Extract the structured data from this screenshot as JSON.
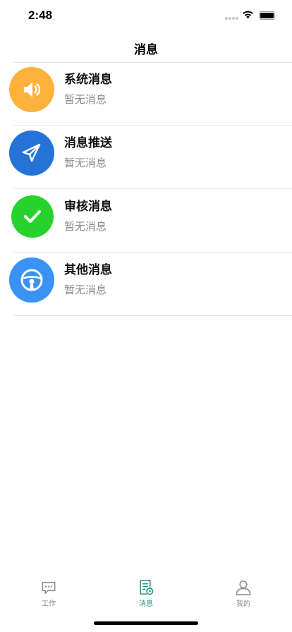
{
  "status_bar": {
    "time": "2:48"
  },
  "header": {
    "title": "消息"
  },
  "messages": [
    {
      "title": "系统消息",
      "subtitle": "暂无消息",
      "icon": "speaker-icon",
      "color": "#ffb13d"
    },
    {
      "title": "消息推送",
      "subtitle": "暂无消息",
      "icon": "paper-plane-icon",
      "color": "#2573d6"
    },
    {
      "title": "审核消息",
      "subtitle": "暂无消息",
      "icon": "checkmark-icon",
      "color": "#27d22d"
    },
    {
      "title": "其他消息",
      "subtitle": "暂无消息",
      "icon": "steering-wheel-icon",
      "color": "#3a93f4"
    }
  ],
  "tab_bar": {
    "active_color": "#2a8f7e",
    "items": [
      {
        "label": "工作",
        "icon": "chat-bubble-icon"
      },
      {
        "label": "消息",
        "icon": "document-icon"
      },
      {
        "label": "我的",
        "icon": "user-icon"
      }
    ]
  }
}
